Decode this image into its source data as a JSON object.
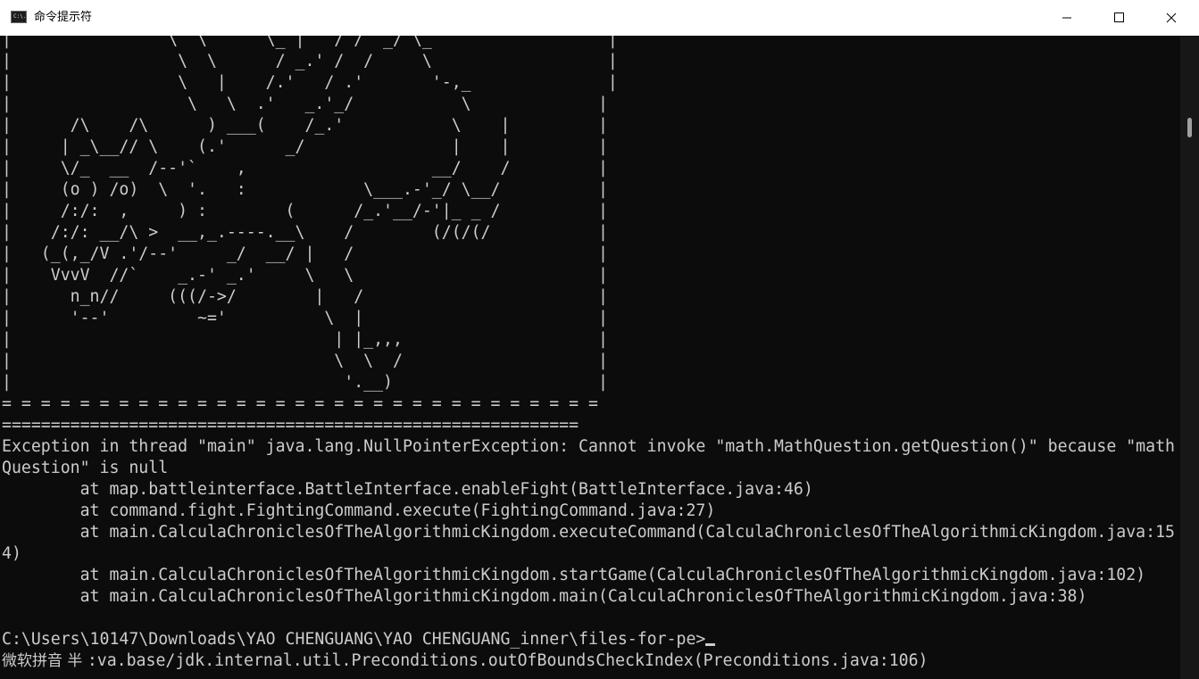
{
  "window": {
    "title": "命令提示符",
    "icon": "cmd-icon",
    "icon_glyph": "C:\\."
  },
  "colors": {
    "console_bg": "#0c0c0c",
    "console_fg": "#cccccc",
    "titlebar_bg": "#ffffff"
  },
  "console": {
    "lines": [
      "|                \\  \\      \\_ |   / /  _/ \\_                  |",
      "|                 \\  \\      / _.' /  /     \\                  |",
      "|                 \\   |    /.'   / .'       '-,_              |",
      "|                  \\   \\  .'   _.'_/           \\             |",
      "|      /\\    /\\      ) ___(    /_.'           \\    |         |",
      "|     | _\\__// \\    (.'      _/               |    |         |",
      "|     \\/_  __  /--'`    ,                   __/    /         |",
      "|     (o ) /o)  \\  '.   :            \\___.-'_/ \\__/          |",
      "|     /:/:  ,     ) :        (      /_.'__/-'|_ _ /          |",
      "|    /:/: __/\\ >  __,_.----.__\\    /        (/(/(/           |",
      "|   (_(,_/V .'/--'     _/  __/ |   /                         |",
      "|    VvvV  //`    _.-' _.'     \\   \\                         |",
      "|      n_n//     (((/->/        |   /                        |",
      "|      '--'         ~='          \\  |                        |",
      "|                                 | |_,,,                    |",
      "|                                 \\  \\  /                    |",
      "|                                  '.__)                     |",
      "= = = = = = = = = = = = = = = = = = = = = = = = = = = = = = =",
      "===========================================================",
      "Exception in thread \"main\" java.lang.NullPointerException: Cannot invoke \"math.MathQuestion.getQuestion()\" because \"math",
      "Question\" is null",
      "        at map.battleinterface.BattleInterface.enableFight(BattleInterface.java:46)",
      "        at command.fight.FightingCommand.execute(FightingCommand.java:27)",
      "        at main.CalculaChroniclesOfTheAlgorithmicKingdom.executeCommand(CalculaChroniclesOfTheAlgorithmicKingdom.java:15",
      "4)",
      "        at main.CalculaChroniclesOfTheAlgorithmicKingdom.startGame(CalculaChroniclesOfTheAlgorithmicKingdom.java:102)",
      "        at main.CalculaChroniclesOfTheAlgorithmicKingdom.main(CalculaChroniclesOfTheAlgorithmicKingdom.java:38)",
      ""
    ],
    "prompt": "C:\\Users\\10147\\Downloads\\YAO CHENGUANG\\YAO CHENGUANG_inner\\files-for-pe>",
    "ime_label": "微软拼音 半 ",
    "ime_tail": ":va.base/jdk.internal.util.Preconditions.outOfBoundsCheckIndex(Preconditions.java:106)"
  }
}
